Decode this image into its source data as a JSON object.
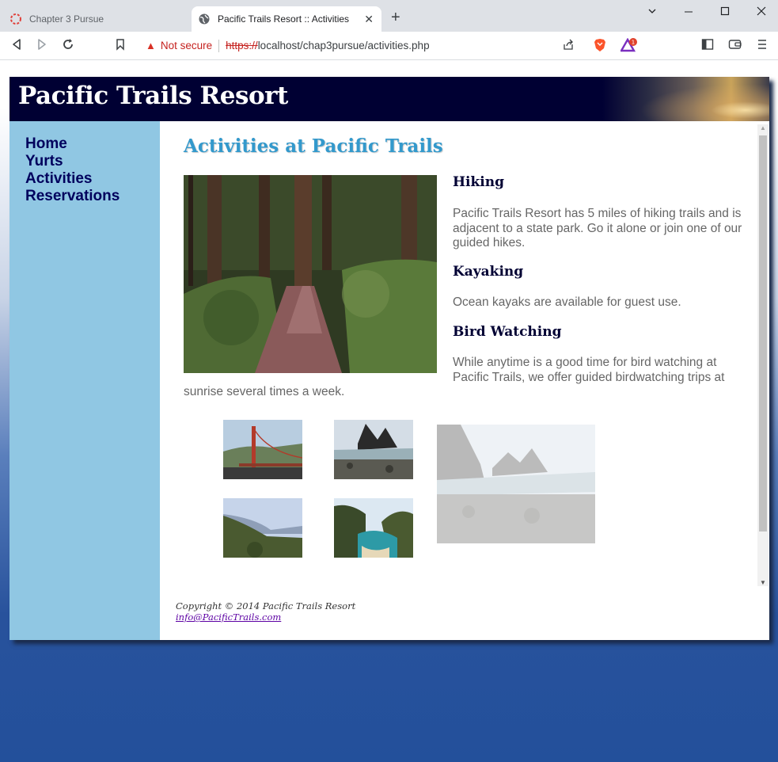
{
  "browser": {
    "tabs": [
      {
        "title": "Chapter 3 Pursue",
        "active": false
      },
      {
        "title": "Pacific Trails Resort :: Activities",
        "active": true
      }
    ],
    "security_label": "Not secure",
    "url_scheme": "https://",
    "url_rest": "localhost/chap3pursue/activities.php",
    "brave_badge_count": "1"
  },
  "site": {
    "title": "Pacific Trails Resort",
    "nav": [
      "Home",
      "Yurts",
      "Activities",
      "Reservations"
    ],
    "heading": "Activities at Pacific Trails",
    "activities": [
      {
        "name": "Hiking",
        "text": "Pacific Trails Resort has 5 miles of hiking trails and is adjacent to a state park. Go it alone or join one of our guided hikes."
      },
      {
        "name": "Kayaking",
        "text": "Ocean kayaks are available for guest use."
      },
      {
        "name": "Bird Watching",
        "text": "While anytime is a good time for bird watching at Pacific Trails, we offer guided birdwatching trips at",
        "text_wrap": "sunrise several times a week."
      }
    ],
    "footer": {
      "copyright": "Copyright © 2014 Pacific Trails Resort",
      "email": "info@PacificTrails.com"
    }
  },
  "colors": {
    "header_bg": "#000033",
    "nav_bg": "#90c7e3",
    "heading": "#3399cc",
    "page_bg_bottom": "#23509b"
  }
}
